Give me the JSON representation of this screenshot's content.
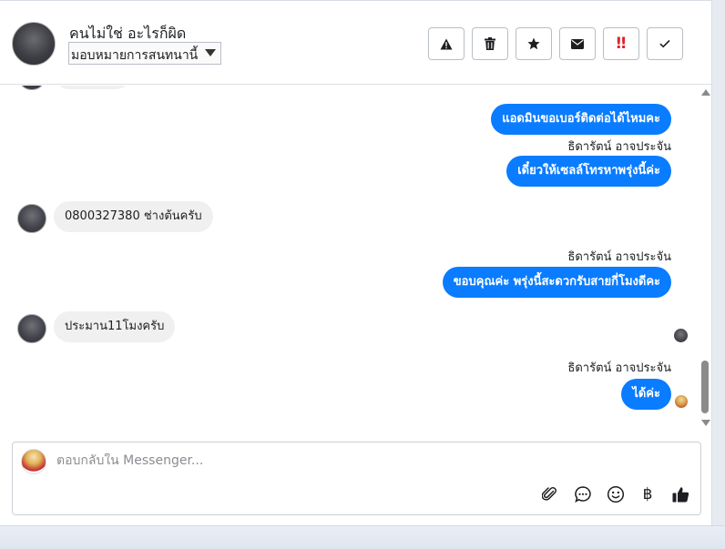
{
  "header": {
    "contact_name": "คนไม่ใช่ อะไรก็ผิด",
    "assign_label": "มอบหมายการสนทนานี้",
    "toolbar": [
      {
        "name": "report-spam-button",
        "icon": "warning-icon"
      },
      {
        "name": "delete-button",
        "icon": "trash-icon"
      },
      {
        "name": "star-button",
        "icon": "star-icon"
      },
      {
        "name": "mark-unread-button",
        "icon": "envelope-icon"
      },
      {
        "name": "mark-important-button",
        "icon": "important-icon",
        "glyph": "‼"
      },
      {
        "name": "mark-done-button",
        "icon": "check-icon"
      }
    ]
  },
  "messages": {
    "out1": "แอดมินขอเบอร์ติดต่อได้ไหมคะ",
    "sender1": "ธิดารัตน์ อาจประจัน",
    "out2": "เดี๋ยวให้เซลล์โทรหาพรุ่งนี้ค่ะ",
    "in1": "0800327380 ช่างต้นครับ",
    "sender2": "ธิดารัตน์ อาจประจัน",
    "out3": "ขอบคุณค่ะ พรุ่งนี้สะดวกรับสายกี่โมงดีคะ",
    "in2": "ประมาน11โมงครับ",
    "sender3": "ธิดารัตน์ อาจประจัน",
    "out4": "ได้ค่ะ"
  },
  "composer": {
    "placeholder": "ตอบกลับใน Messenger...",
    "icons": [
      "paperclip-icon",
      "saved-reply-icon",
      "emoji-icon",
      "baht-icon",
      "thumbs-up-icon"
    ],
    "baht_glyph": "฿"
  },
  "colors": {
    "outgoing_bubble": "#0a7cff",
    "incoming_bubble": "#f0f0f0",
    "important": "#e0232a"
  }
}
